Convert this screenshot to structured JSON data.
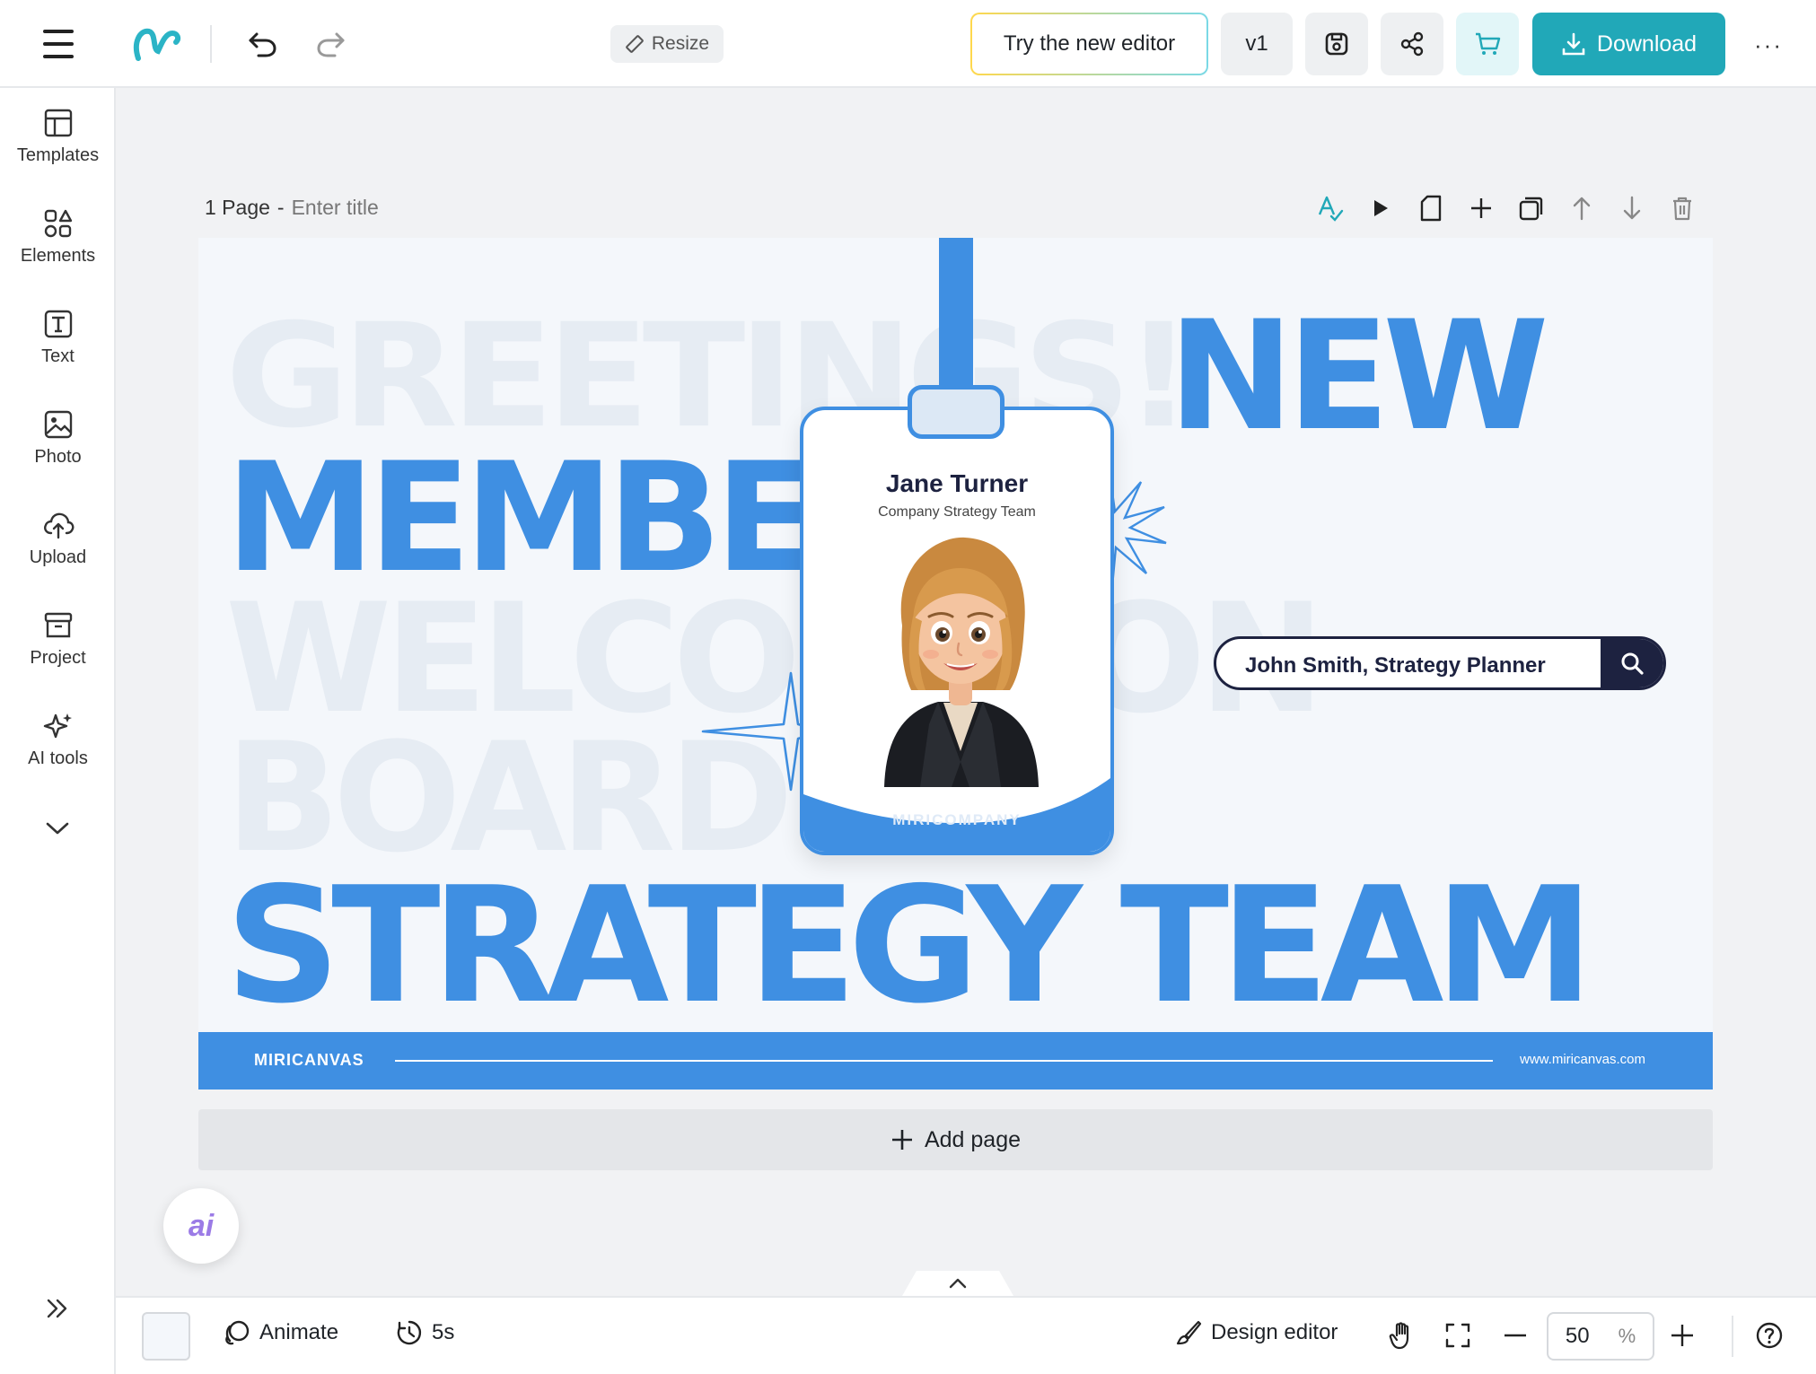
{
  "topbar": {
    "resize_label": "Resize",
    "try_editor_label": "Try the new editor",
    "version_label": "v1",
    "download_label": "Download",
    "more_label": "···"
  },
  "sidebar": {
    "items": [
      {
        "label": "Templates",
        "icon": "template-icon"
      },
      {
        "label": "Elements",
        "icon": "elements-icon"
      },
      {
        "label": "Text",
        "icon": "text-icon"
      },
      {
        "label": "Photo",
        "icon": "photo-icon"
      },
      {
        "label": "Upload",
        "icon": "upload-icon"
      },
      {
        "label": "Project",
        "icon": "project-icon"
      },
      {
        "label": "AI tools",
        "icon": "ai-tools-icon"
      }
    ]
  },
  "page": {
    "count_label": "1 Page",
    "separator": "-",
    "title_placeholder": "Enter title"
  },
  "design": {
    "ghost_line1": "GREETINGS!",
    "line_new": "NEW",
    "line_member": "MEMBER",
    "ghost_line2": "WELCOME ON",
    "ghost_line3": "BOARD",
    "line_team": "STRATEGY TEAM",
    "badge_name": "Jane Turner",
    "badge_team": "Company Strategy Team",
    "badge_company": "MIRICOMPANY",
    "search_text": "John Smith, Strategy Planner",
    "footer_brand": "MIRICANVAS",
    "footer_url": "www.miricanvas.com",
    "accent_color": "#3f8fe2",
    "dark_color": "#1d2240"
  },
  "add_page_label": "Add page",
  "ai_fab_label": "ai",
  "bottombar": {
    "animate_label": "Animate",
    "duration_label": "5s",
    "design_editor_label": "Design editor",
    "zoom_value": "50",
    "zoom_unit": "%"
  },
  "colors": {
    "download_bg": "#21a8b8",
    "logo": "#2bb4c6"
  }
}
